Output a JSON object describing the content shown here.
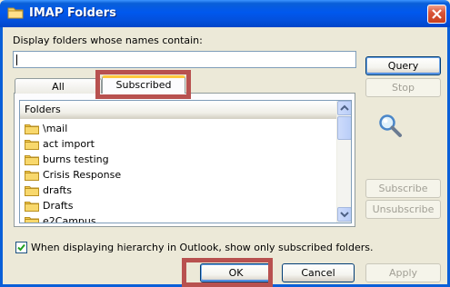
{
  "window": {
    "title": "IMAP Folders",
    "close_icon": "close-icon",
    "title_icon": "folder-icon"
  },
  "filter": {
    "label": "Display folders whose names contain:",
    "value": "",
    "placeholder": ""
  },
  "tabs": [
    {
      "label": "All",
      "active": false
    },
    {
      "label": "Subscribed",
      "active": true
    }
  ],
  "list": {
    "header": "Folders",
    "items": [
      {
        "label": "\\mail"
      },
      {
        "label": "act import"
      },
      {
        "label": "burns testing"
      },
      {
        "label": "Crisis Response"
      },
      {
        "label": "drafts"
      },
      {
        "label": "Drafts"
      },
      {
        "label": "e2Campus"
      }
    ]
  },
  "side_buttons": {
    "query": "Query",
    "stop": "Stop",
    "subscribe": "Subscribe",
    "unsubscribe": "Unsubscribe",
    "search_icon": "magnifier-icon"
  },
  "hierarchy_option": {
    "label": "When displaying hierarchy in Outlook, show only subscribed folders.",
    "checked": true
  },
  "footer": {
    "ok": "OK",
    "cancel": "Cancel",
    "apply": "Apply"
  },
  "colors": {
    "title_bar": "#0058ee",
    "highlight": "#b8514f",
    "active_tab_accent": "#ffc83c",
    "folder": "#f2c94c"
  }
}
